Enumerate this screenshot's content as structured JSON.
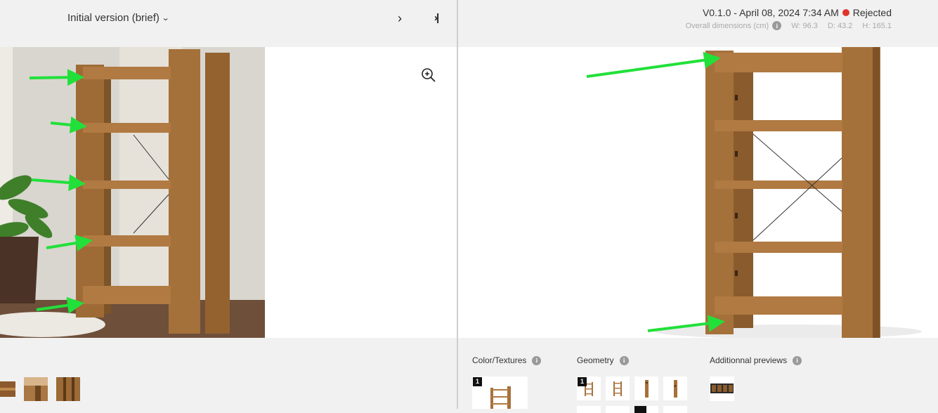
{
  "header": {
    "version_select_label": "Initial version (brief)",
    "next_symbol": "›",
    "last_symbol": "›|"
  },
  "version": {
    "label": "V0.1.0 - April 08, 2024 7:34 AM",
    "status": "Rejected",
    "status_color": "#e0352b"
  },
  "dimensions": {
    "label": "Overall dimensions (cm)",
    "w": "W: 96.3",
    "d": "D: 43.2",
    "h": "H: 165.1"
  },
  "sections": {
    "color_textures": "Color/Textures",
    "geometry": "Geometry",
    "additional_previews": "Additionnal previews"
  },
  "badges": {
    "texture": "1",
    "geometry": "1"
  },
  "info_glyph": "i",
  "colors": {
    "wood": "#a5713a",
    "arrow": "#22e03a",
    "background": "#f1f1f1"
  }
}
